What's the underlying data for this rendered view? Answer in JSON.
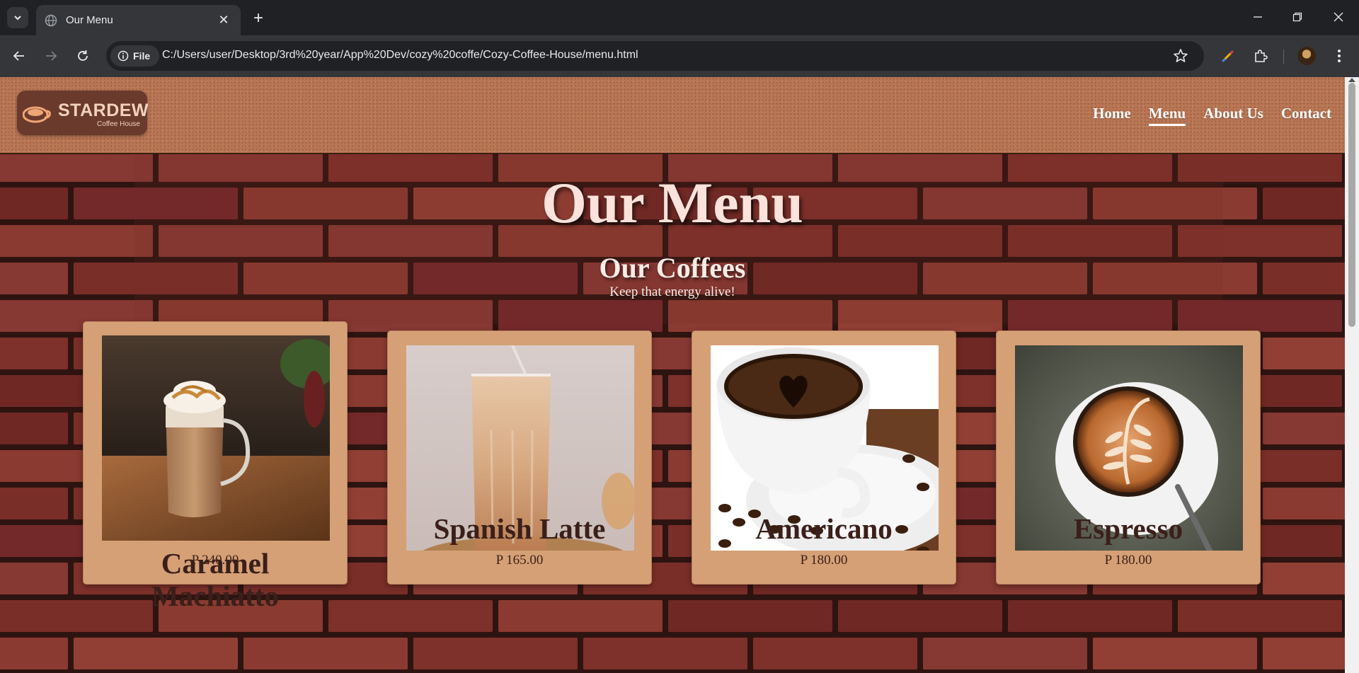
{
  "browser": {
    "tab_title": "Our Menu",
    "url": "C:/Users/user/Desktop/3rd%20year/App%20Dev/cozy%20coffe/Cozy-Coffee-House/menu.html",
    "site_chip_label": "File"
  },
  "site": {
    "logo": {
      "brand": "STARDEW",
      "sub": "Coffee House"
    },
    "nav": [
      {
        "label": "Home",
        "active": false
      },
      {
        "label": "Menu",
        "active": true
      },
      {
        "label": "About Us",
        "active": false
      },
      {
        "label": "Contact",
        "active": false
      }
    ]
  },
  "hero": {
    "title": "Our Menu"
  },
  "section": {
    "title": "Our Coffees",
    "subtitle": "Keep that energy alive!"
  },
  "menu_items": [
    {
      "name": "Caramel Machiatto",
      "price": "P 240.00",
      "image": "caramel-machiatto-photo"
    },
    {
      "name": "Spanish Latte",
      "price": "P 165.00",
      "image": "spanish-latte-photo"
    },
    {
      "name": "Americano",
      "price": "P 180.00",
      "image": "americano-photo"
    },
    {
      "name": "Espresso",
      "price": "P 180.00",
      "image": "espresso-photo"
    }
  ],
  "colors": {
    "card_bg": "#d5a075",
    "header_bg": "#b87655",
    "brick": "#7a2e28",
    "text_dark": "#3b1f1a"
  }
}
